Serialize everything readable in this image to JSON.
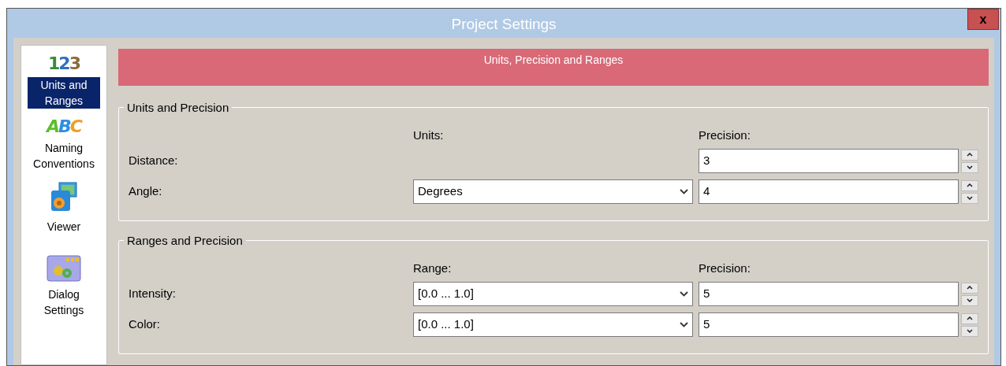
{
  "window": {
    "title": "Project Settings",
    "close": "x"
  },
  "sidebar": {
    "items": [
      {
        "icon_text": "123",
        "label": "Units and Ranges",
        "selected": true
      },
      {
        "icon_text": "ABC",
        "label": "Naming Conventions",
        "selected": false
      },
      {
        "label": "Viewer",
        "selected": false
      },
      {
        "label": "Dialog Settings",
        "selected": false
      }
    ]
  },
  "banner": "Units, Precision and Ranges",
  "groups": [
    {
      "title": "Units and Precision",
      "col_1": "Units:",
      "col_2": "Precision:",
      "rows": [
        {
          "label": "Distance:",
          "precision": "3"
        },
        {
          "label": "Angle:",
          "value": "Degrees",
          "precision": "4"
        }
      ]
    },
    {
      "title": "Ranges and Precision",
      "col_1": "Range:",
      "col_2": "Precision:",
      "rows": [
        {
          "label": "Intensity:",
          "value": "[0.0 ... 1.0]",
          "precision": "5"
        },
        {
          "label": "Color:",
          "value": "[0.0 ... 1.0]",
          "precision": "5"
        }
      ]
    }
  ]
}
